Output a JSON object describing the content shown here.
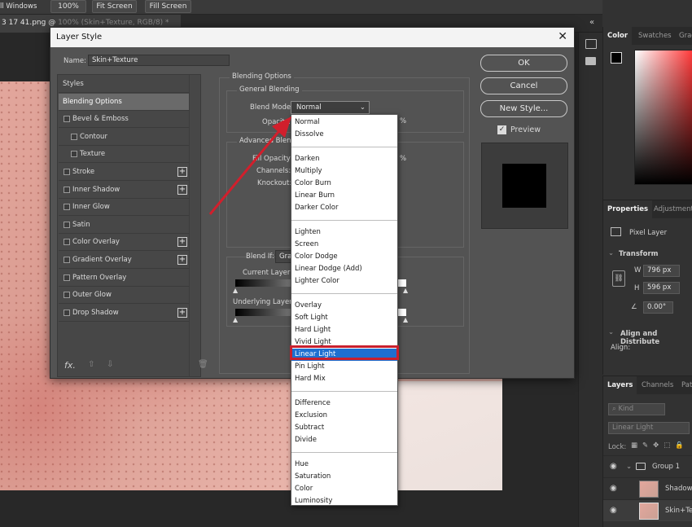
{
  "toolbar": {
    "windows_label": "ll Windows",
    "zoom_100_label": "100%",
    "fit_screen_label": "Fit Screen",
    "fill_screen_label": "Fill Screen"
  },
  "document_tab": {
    "title": "3 17 41.png @ ",
    "title_dim": "100% (Skin+Texture, RGB/8) *"
  },
  "dialog": {
    "title": "Layer Style",
    "name_label": "Name:",
    "name_value": "Skin+Texture",
    "ok_label": "OK",
    "cancel_label": "Cancel",
    "new_style_label": "New Style...",
    "preview_label": "Preview",
    "styles_list": [
      {
        "label": "Styles",
        "checkbox": false,
        "plus": false,
        "indent": false
      },
      {
        "label": "Blending Options",
        "checkbox": false,
        "plus": false,
        "indent": false,
        "selected": true
      },
      {
        "label": "Bevel & Emboss",
        "checkbox": true,
        "plus": false,
        "indent": false
      },
      {
        "label": "Contour",
        "checkbox": true,
        "plus": false,
        "indent": true
      },
      {
        "label": "Texture",
        "checkbox": true,
        "plus": false,
        "indent": true
      },
      {
        "label": "Stroke",
        "checkbox": true,
        "plus": true,
        "indent": false
      },
      {
        "label": "Inner Shadow",
        "checkbox": true,
        "plus": true,
        "indent": false
      },
      {
        "label": "Inner Glow",
        "checkbox": true,
        "plus": false,
        "indent": false
      },
      {
        "label": "Satin",
        "checkbox": true,
        "plus": false,
        "indent": false
      },
      {
        "label": "Color Overlay",
        "checkbox": true,
        "plus": true,
        "indent": false
      },
      {
        "label": "Gradient Overlay",
        "checkbox": true,
        "plus": true,
        "indent": false
      },
      {
        "label": "Pattern Overlay",
        "checkbox": true,
        "plus": false,
        "indent": false
      },
      {
        "label": "Outer Glow",
        "checkbox": true,
        "plus": false,
        "indent": false
      },
      {
        "label": "Drop Shadow",
        "checkbox": true,
        "plus": true,
        "indent": false
      }
    ],
    "fx_label": "fx.",
    "blending_options_title": "Blending Options",
    "general_blending_title": "General Blending",
    "blend_mode_label": "Blend Mode:",
    "blend_mode_value": "Normal",
    "opacity_label": "Opacity:",
    "percent_sign": "%",
    "advanced_blending_title": "Advanced Blending",
    "fill_opacity_label": "Fill Opacity:",
    "channels_label": "Channels:",
    "knockout_label": "Knockout:",
    "blend_if_label": "Blend If:",
    "blend_if_value": "Gra",
    "current_layer_label": "Current Layer:",
    "underlying_layer_label": "Underlying Layer:"
  },
  "blend_menu": [
    [
      "Normal",
      "Dissolve"
    ],
    [
      "Darken",
      "Multiply",
      "Color Burn",
      "Linear Burn",
      "Darker Color"
    ],
    [
      "Lighten",
      "Screen",
      "Color Dodge",
      "Linear Dodge (Add)",
      "Lighter Color"
    ],
    [
      "Overlay",
      "Soft Light",
      "Hard Light",
      "Vivid Light",
      "Linear Light",
      "Pin Light",
      "Hard Mix"
    ],
    [
      "Difference",
      "Exclusion",
      "Subtract",
      "Divide"
    ],
    [
      "Hue",
      "Saturation",
      "Color",
      "Luminosity"
    ]
  ],
  "blend_menu_highlighted": "Linear Light",
  "right_panels": {
    "color_tabs": [
      "Color",
      "Swatches",
      "Gradi"
    ],
    "properties_tabs": [
      "Properties",
      "Adjustments"
    ],
    "pixel_layer_label": "Pixel Layer",
    "transform_label": "Transform",
    "w_label": "W",
    "w_value": "796 px",
    "h_label": "H",
    "h_value": "596 px",
    "angle_value": "0.00°",
    "align_label": "Align and Distribute",
    "align_sub": "Align:",
    "layers_tabs": [
      "Layers",
      "Channels",
      "Pat"
    ],
    "kind_placeholder": "Kind",
    "blend_value": "Linear Light",
    "lock_label": "Lock:",
    "layers": [
      "Group 1",
      "Shadow+",
      "Skin+Tex"
    ]
  },
  "colors": {
    "accent_red": "#c8202e",
    "menu_highlight": "#1e6fd0"
  }
}
